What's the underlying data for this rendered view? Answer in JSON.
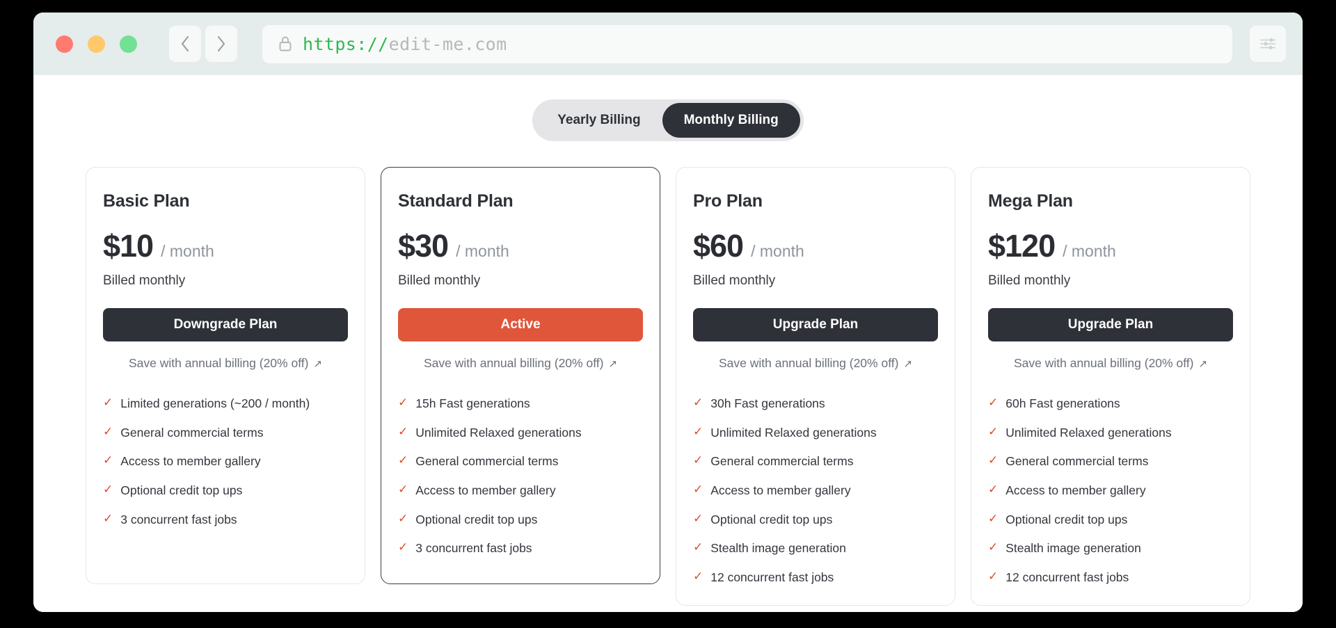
{
  "browser": {
    "traffic_lights": [
      "close",
      "minimize",
      "maximize"
    ],
    "back_label": "Back",
    "forward_label": "Forward",
    "url_protocol": "https://",
    "url_host": "edit-me.com",
    "lock_icon": "lock-icon",
    "menu_icon": "sliders-icon"
  },
  "billing_toggle": {
    "options": [
      {
        "label": "Yearly Billing",
        "active": false
      },
      {
        "label": "Monthly Billing",
        "active": true
      }
    ]
  },
  "colors": {
    "accent": "#e0563b",
    "dark": "#2e3138",
    "check": "#e04a2f",
    "chrome_bg": "#e5ecec",
    "page_bg": "#000000"
  },
  "save_link": {
    "label": "Save with annual billing (20% off)",
    "arrow": "↗"
  },
  "plans": [
    {
      "name": "Basic Plan",
      "price": "$10",
      "period": "/ month",
      "billed": "Billed monthly",
      "cta": "Downgrade Plan",
      "featured": false,
      "features": [
        "Limited generations (~200 / month)",
        "General commercial terms",
        "Access to member gallery",
        "Optional credit top ups",
        "3 concurrent fast jobs"
      ]
    },
    {
      "name": "Standard Plan",
      "price": "$30",
      "period": "/ month",
      "billed": "Billed monthly",
      "cta": "Active",
      "featured": true,
      "features": [
        "15h Fast generations",
        "Unlimited Relaxed generations",
        "General commercial terms",
        "Access to member gallery",
        "Optional credit top ups",
        "3 concurrent fast jobs"
      ]
    },
    {
      "name": "Pro Plan",
      "price": "$60",
      "period": "/ month",
      "billed": "Billed monthly",
      "cta": "Upgrade Plan",
      "featured": false,
      "features": [
        "30h Fast generations",
        "Unlimited Relaxed generations",
        "General commercial terms",
        "Access to member gallery",
        "Optional credit top ups",
        "Stealth image generation",
        "12 concurrent fast jobs"
      ]
    },
    {
      "name": "Mega Plan",
      "price": "$120",
      "period": "/ month",
      "billed": "Billed monthly",
      "cta": "Upgrade Plan",
      "featured": false,
      "features": [
        "60h Fast generations",
        "Unlimited Relaxed generations",
        "General commercial terms",
        "Access to member gallery",
        "Optional credit top ups",
        "Stealth image generation",
        "12 concurrent fast jobs"
      ]
    }
  ]
}
